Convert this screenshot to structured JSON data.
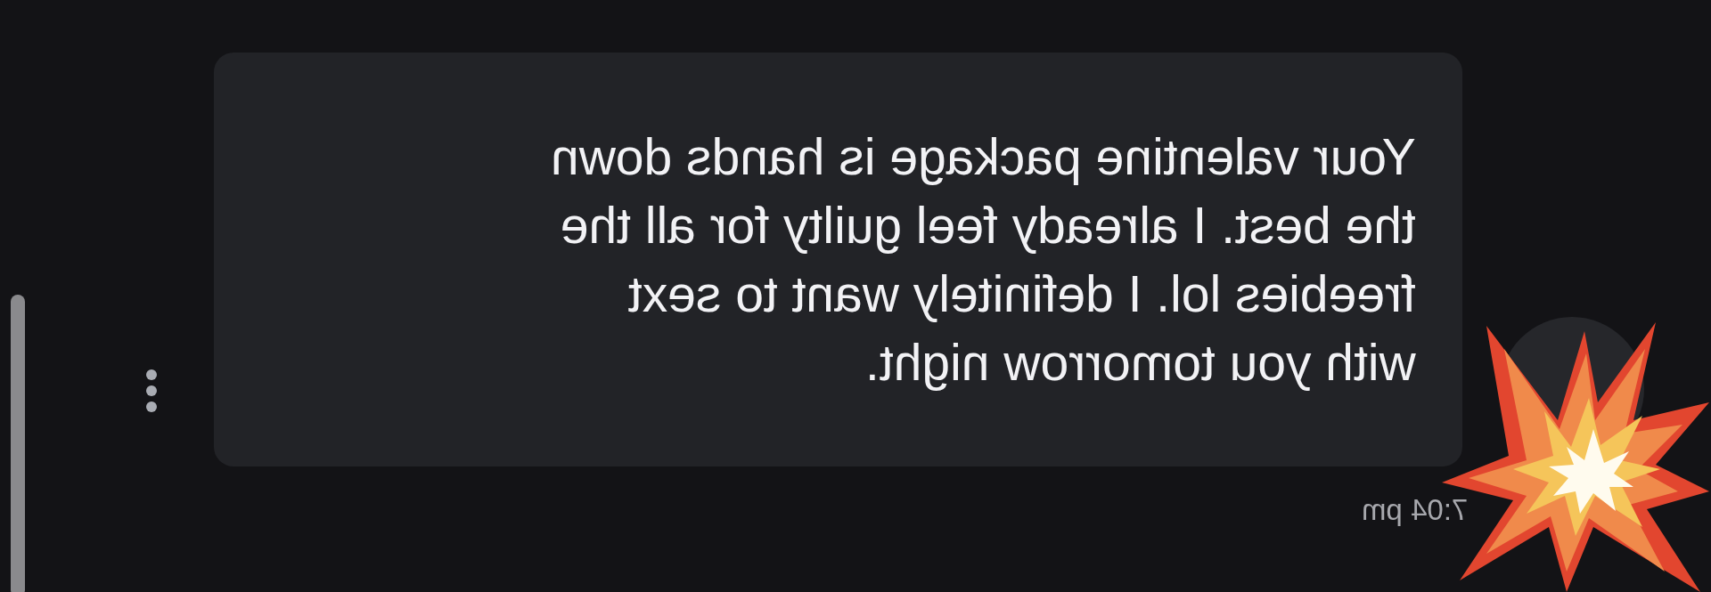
{
  "message": {
    "text": "Your valentine package is hands down\nthe best. I already feel guilty for all the\nfreebies lol. I definitely want to sext\nwith you tomorrow night.",
    "time": "7:04 pm",
    "mirrored": true
  }
}
